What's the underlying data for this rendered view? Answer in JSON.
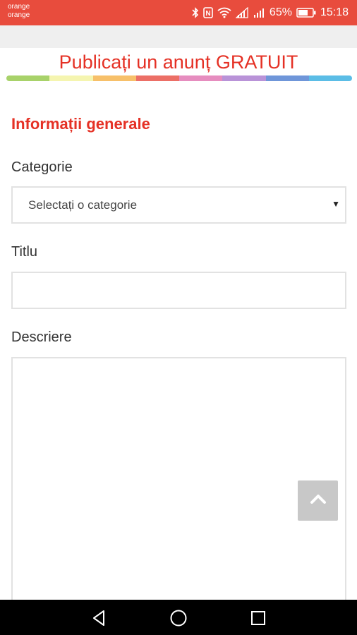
{
  "status_bar": {
    "carrier_line1": "orange",
    "carrier_line2": "orange",
    "battery_percent": "65%",
    "time": "15:18",
    "background_color": "#e84c3d",
    "icons": [
      "bluetooth-icon",
      "nfc-icon",
      "wifi-icon",
      "signal-icon",
      "signal-icon",
      "battery-icon"
    ]
  },
  "header": {
    "title": "Publicați un anunț GRATUIT",
    "title_color": "#e53125",
    "rainbow_colors": [
      "#a8d26a",
      "#f5f5b0",
      "#f7c06a",
      "#ec6f66",
      "#e68dbf",
      "#b993d8",
      "#6f96d9",
      "#5bbde6"
    ]
  },
  "form": {
    "section_title": "Informații generale",
    "category_label": "Categorie",
    "category_value": "Selectați o categorie",
    "title_label": "Titlu",
    "title_value": "",
    "description_label": "Descriere",
    "description_value": ""
  },
  "scroll_top": {
    "icon": "chevron-up-icon"
  },
  "nav_bar": {
    "icons": [
      "back-icon",
      "home-icon",
      "recents-icon"
    ]
  }
}
